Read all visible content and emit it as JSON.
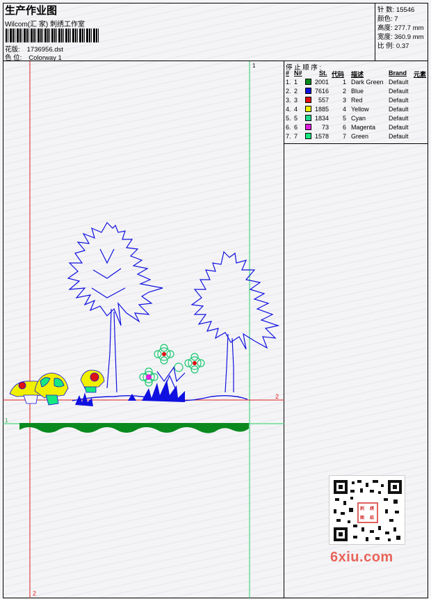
{
  "header": {
    "title": "生产作业图",
    "company": "Wilcom(汇 家) 刺绣工作室",
    "pattern_label": "花版:",
    "pattern_value": "1736956.dst",
    "colorway_label": "色 位:",
    "colorway_value": "Colorway 1"
  },
  "stats": [
    {
      "label": "针 数:",
      "value": "15546"
    },
    {
      "label": "颜色:",
      "value": "7"
    },
    {
      "label": "高度:",
      "value": "277.7 mm"
    },
    {
      "label": "宽度:",
      "value": "360.9 mm"
    },
    {
      "label": "比 例:",
      "value": "0.37"
    }
  ],
  "stop_sequence": {
    "title": "停 止 顺 序 :",
    "columns": [
      "#",
      "N#",
      "St.",
      "代码",
      "描述",
      "Brand",
      "元素"
    ],
    "rows": [
      {
        "index": "1.",
        "needle": "1",
        "stitches": "2001",
        "code": "1",
        "desc": "Dark Green",
        "brand": "Default",
        "color": "#0a8a1e"
      },
      {
        "index": "2.",
        "needle": "2",
        "stitches": "7616",
        "code": "2",
        "desc": "Blue",
        "brand": "Default",
        "color": "#1010e0"
      },
      {
        "index": "3.",
        "needle": "3",
        "stitches": "557",
        "code": "3",
        "desc": "Red",
        "brand": "Default",
        "color": "#e01010"
      },
      {
        "index": "4.",
        "needle": "4",
        "stitches": "1885",
        "code": "4",
        "desc": "Yellow",
        "brand": "Default",
        "color": "#f0f000"
      },
      {
        "index": "5.",
        "needle": "5",
        "stitches": "1834",
        "code": "5",
        "desc": "Cyan",
        "brand": "Default",
        "color": "#20d890"
      },
      {
        "index": "6.",
        "needle": "6",
        "stitches": "73",
        "code": "6",
        "desc": "Magenta",
        "brand": "Default",
        "color": "#e020e0"
      },
      {
        "index": "7.",
        "needle": "7",
        "stitches": "1578",
        "code": "7",
        "desc": "Green",
        "brand": "Default",
        "color": "#18e880"
      }
    ]
  },
  "guides": {
    "v_red_label": "2",
    "v_green_label": "1",
    "h_red_label": "2",
    "h_green_label": "1"
  },
  "watermark": "6xiu.com",
  "qr_mark_text": [
    "刺",
    "绣",
    "图",
    "纸"
  ]
}
